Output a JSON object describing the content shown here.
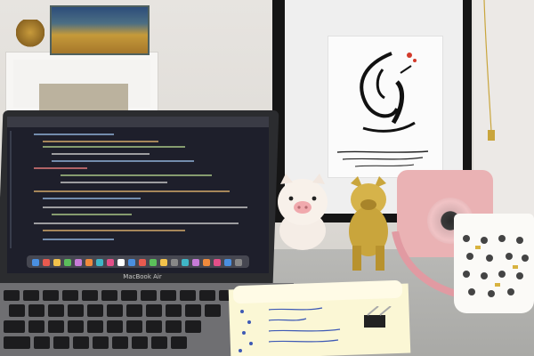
{
  "scene": {
    "laptop_brand_text": "MacBook Air",
    "colors": {
      "wall": "#e2dfdb",
      "desk": "#b2b2af",
      "frame": "#151515",
      "camera": "#eab2b4",
      "gold": "#c9a53c",
      "notepad": "#fbf7d5",
      "screen": "#1e1f2b"
    },
    "objects": [
      "laptop",
      "framed-calligraphy",
      "piggy-figurine",
      "gold-bulldog-figurine",
      "instant-camera",
      "patterned-mug",
      "notepad",
      "binder-clip",
      "shelf-with-painting",
      "gold-necklace"
    ]
  }
}
